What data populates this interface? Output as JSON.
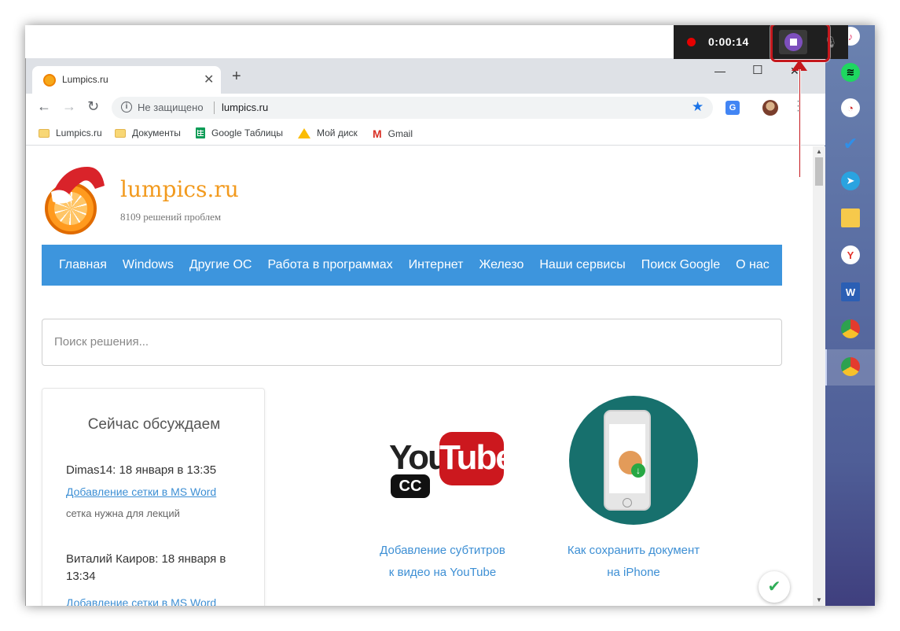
{
  "recorder": {
    "time": "0:00:14"
  },
  "browser": {
    "tab_title": "Lumpics.ru",
    "address": {
      "security": "Не защищено",
      "url": "lumpics.ru"
    },
    "bookmarks": [
      {
        "label": "Lumpics.ru",
        "icon": "folder-icon"
      },
      {
        "label": "Документы",
        "icon": "folder-icon"
      },
      {
        "label": "Google Таблицы",
        "icon": "sheets-icon"
      },
      {
        "label": "Мой диск",
        "icon": "drive-icon"
      },
      {
        "label": "Gmail",
        "icon": "gmail-icon"
      }
    ]
  },
  "site": {
    "title": "lumpics.ru",
    "subtitle": "8109 решений проблем",
    "nav": [
      "Главная",
      "Windows",
      "Другие ОС",
      "Работа в программах",
      "Интернет",
      "Железо",
      "Наши сервисы",
      "Поиск Google",
      "О нас"
    ],
    "search_placeholder": "Поиск решения...",
    "discuss": {
      "title": "Сейчас обсуждаем",
      "comments": [
        {
          "author": "Dimas14: 18 января в 13:35",
          "link": "Добавление сетки в MS Word",
          "text": "сетка нужна для лекций"
        },
        {
          "author": "Виталий Каиров: 18 января в 13:34",
          "link": "Добавление сетки в MS Word"
        }
      ]
    },
    "cards": [
      {
        "caption_line1": "Добавление субтитров",
        "caption_line2": "к видео на YouTube",
        "logo_you": "You",
        "logo_tube": "Tube",
        "logo_cc": "CC"
      },
      {
        "caption_line1": "Как сохранить документ",
        "caption_line2": "на iPhone"
      }
    ]
  },
  "colors": {
    "accent": "#3d95dd",
    "link": "#3d8fd4",
    "brand_orange": "#f29a1e",
    "record_red": "#e60000",
    "annotation_red": "#c5181d"
  }
}
